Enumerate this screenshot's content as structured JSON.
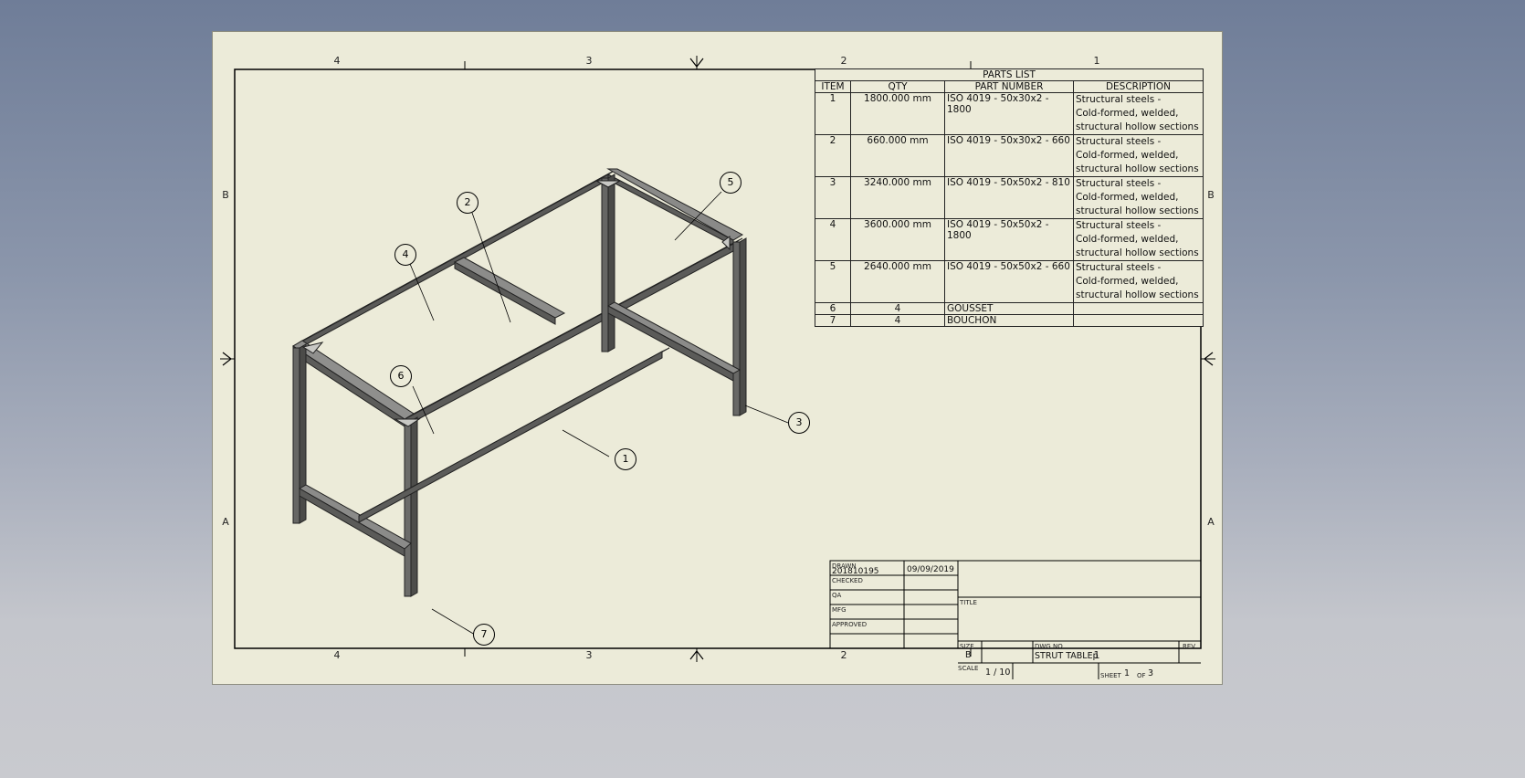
{
  "parts_list": {
    "title": "PARTS LIST",
    "columns": [
      "ITEM",
      "QTY",
      "PART NUMBER",
      "DESCRIPTION"
    ],
    "rows": [
      {
        "item": "1",
        "qty": "1800.000 mm",
        "part": "ISO 4019 - 50x30x2 - 1800",
        "desc": [
          "Structural steels -",
          "Cold-formed, welded,",
          "structural hollow sections"
        ]
      },
      {
        "item": "2",
        "qty": "660.000 mm",
        "part": "ISO 4019 - 50x30x2 - 660",
        "desc": [
          "Structural steels -",
          "Cold-formed, welded,",
          "structural hollow sections"
        ]
      },
      {
        "item": "3",
        "qty": "3240.000 mm",
        "part": "ISO 4019 - 50x50x2 - 810",
        "desc": [
          "Structural steels -",
          "Cold-formed, welded,",
          "structural hollow sections"
        ]
      },
      {
        "item": "4",
        "qty": "3600.000 mm",
        "part": "ISO 4019 - 50x50x2 - 1800",
        "desc": [
          "Structural steels -",
          "Cold-formed, welded,",
          "structural hollow sections"
        ]
      },
      {
        "item": "5",
        "qty": "2640.000 mm",
        "part": "ISO 4019 - 50x50x2 - 660",
        "desc": [
          "Structural steels -",
          "Cold-formed, welded,",
          "structural hollow sections"
        ]
      },
      {
        "item": "6",
        "qty": "4",
        "part": "GOUSSET",
        "desc": []
      },
      {
        "item": "7",
        "qty": "4",
        "part": "BOUCHON",
        "desc": []
      }
    ]
  },
  "zones": {
    "columns": [
      "4",
      "3",
      "2",
      "1"
    ],
    "rows": [
      "B",
      "A"
    ]
  },
  "balloons": [
    "1",
    "2",
    "3",
    "4",
    "5",
    "6",
    "7"
  ],
  "title_block": {
    "drawn_label": "DRAWN",
    "drawn_by": "201810195",
    "drawn_date": "09/09/2019",
    "checked_label": "CHECKED",
    "qa_label": "QA",
    "mfg_label": "MFG",
    "approved_label": "APPROVED",
    "title_label": "TITLE",
    "size_label": "SIZE",
    "size_value": "B",
    "dwg_label": "DWG NO",
    "dwg_value": "STRUT TABLEp",
    "rev_label": "REV",
    "scale_label": "SCALE",
    "scale_value": "1 / 10",
    "sheet_label": "SHEET",
    "sheet_value": "1",
    "of_label": "OF",
    "of_value": "3"
  }
}
